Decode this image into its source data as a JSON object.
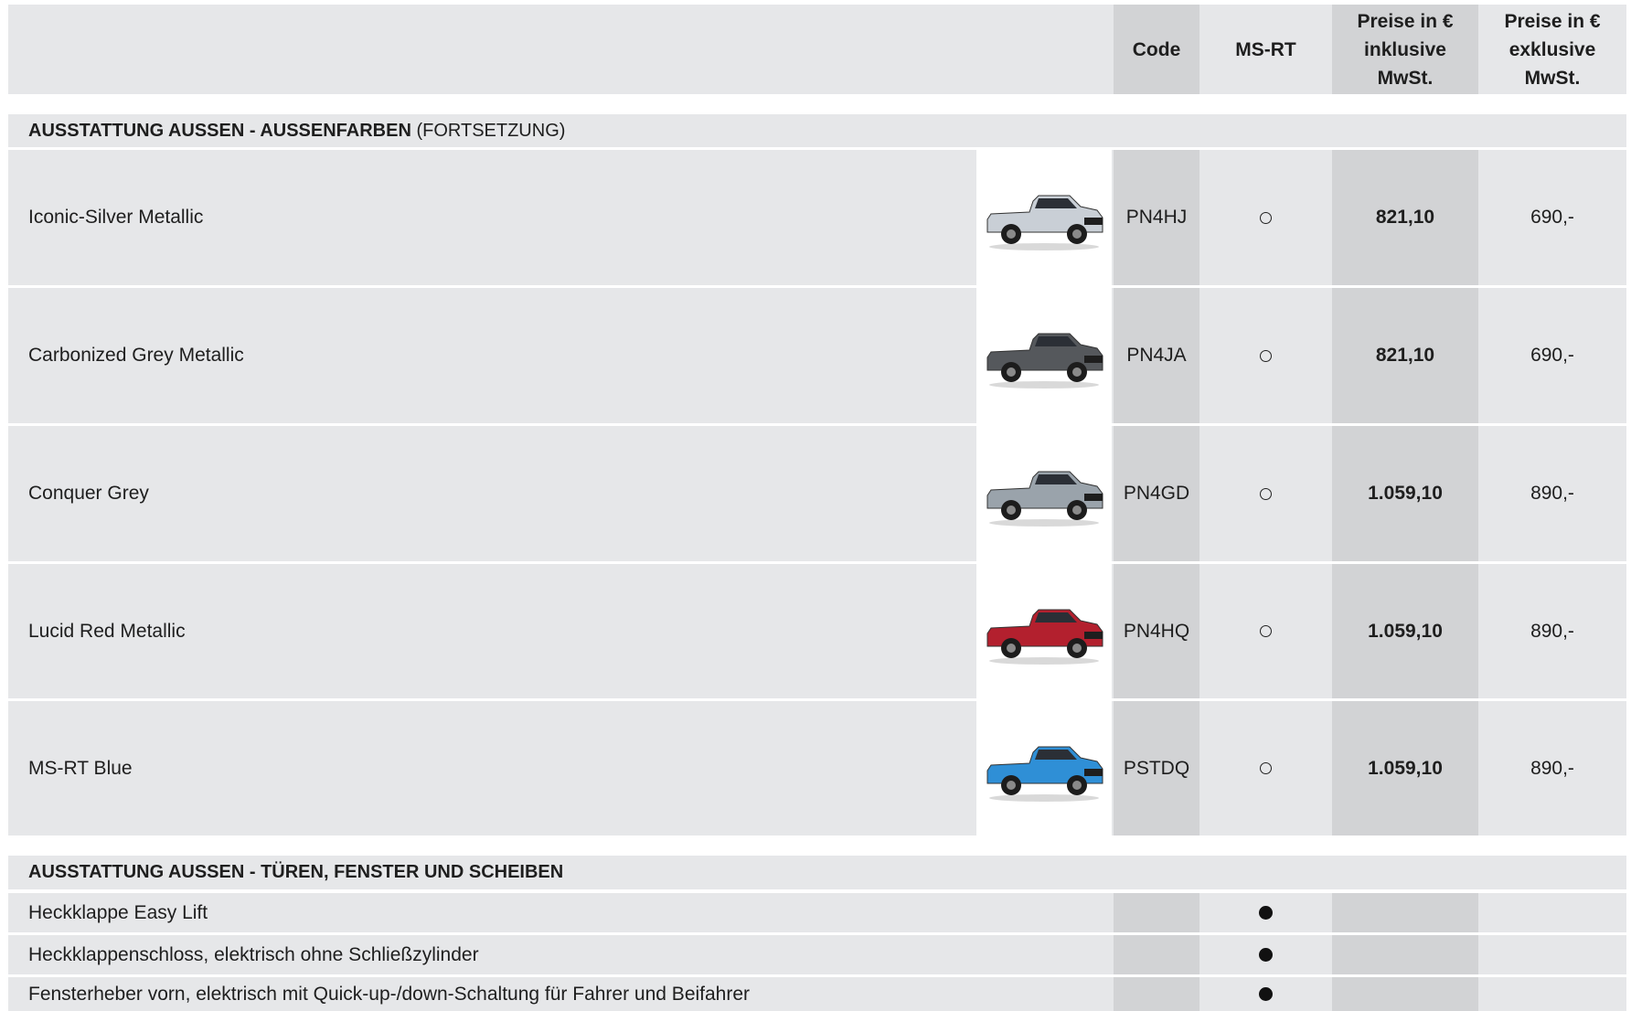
{
  "header": {
    "code": "Code",
    "msrt": "MS-RT",
    "preis_inkl": [
      "Preise in €",
      "inklusive",
      "MwSt."
    ],
    "preis_exkl": [
      "Preise in €",
      "exklusive",
      "MwSt."
    ]
  },
  "section1": {
    "title_bold": "AUSSTATTUNG AUSSEN - AUSSENFARBEN",
    "title_suffix": " (FORTSETZUNG)",
    "rows": [
      {
        "label": "Iconic-Silver Metallic",
        "code": "PN4HJ",
        "price_inkl": "821,10",
        "price_exkl": "690,-",
        "body_color": "#c9cfd6",
        "icon": "silver-pickup-truck-image"
      },
      {
        "label": "Carbonized Grey Metallic",
        "code": "PN4JA",
        "price_inkl": "821,10",
        "price_exkl": "690,-",
        "body_color": "#55585c",
        "icon": "grey-pickup-truck-image"
      },
      {
        "label": "Conquer Grey",
        "code": "PN4GD",
        "price_inkl": "1.059,10",
        "price_exkl": "890,-",
        "body_color": "#9aa3ab",
        "icon": "conquer-grey-pickup-truck-image"
      },
      {
        "label": "Lucid Red Metallic",
        "code": "PN4HQ",
        "price_inkl": "1.059,10",
        "price_exkl": "890,-",
        "body_color": "#b3202e",
        "icon": "red-pickup-truck-image"
      },
      {
        "label": "MS-RT Blue",
        "code": "PSTDQ",
        "price_inkl": "1.059,10",
        "price_exkl": "890,-",
        "body_color": "#2f8fd6",
        "icon": "blue-pickup-truck-image"
      }
    ]
  },
  "section2": {
    "title_bold": "AUSSTATTUNG AUSSEN - TÜREN, FENSTER UND SCHEIBEN",
    "rows": [
      {
        "label": "Heckklappe Easy Lift"
      },
      {
        "label": "Heckklappenschloss, elektrisch ohne Schließzylinder"
      },
      {
        "label": "Fensterheber vorn, elektrisch mit Quick-up-/down-Schaltung für Fahrer und Beifahrer"
      }
    ]
  },
  "legend": {
    "optional_symbol": "open-circle-icon",
    "standard_symbol": "filled-circle-icon"
  }
}
